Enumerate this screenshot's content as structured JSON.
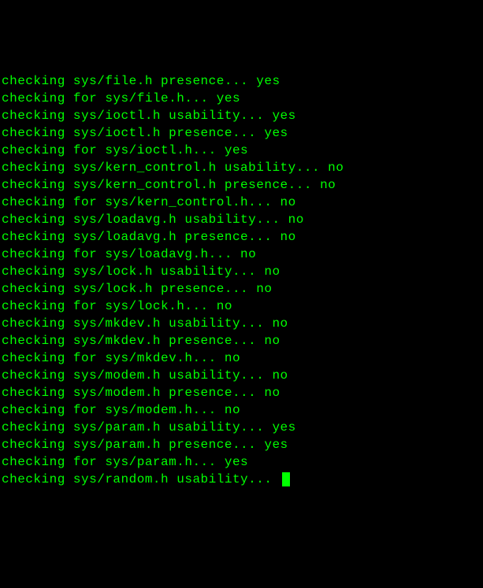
{
  "terminal": {
    "lines": [
      {
        "text": "checking sys/file.h presence... yes"
      },
      {
        "text": "checking for sys/file.h... yes"
      },
      {
        "text": "checking sys/ioctl.h usability... yes"
      },
      {
        "text": "checking sys/ioctl.h presence... yes"
      },
      {
        "text": "checking for sys/ioctl.h... yes"
      },
      {
        "text": "checking sys/kern_control.h usability... no"
      },
      {
        "text": "checking sys/kern_control.h presence... no"
      },
      {
        "text": "checking for sys/kern_control.h... no"
      },
      {
        "text": "checking sys/loadavg.h usability... no"
      },
      {
        "text": "checking sys/loadavg.h presence... no"
      },
      {
        "text": "checking for sys/loadavg.h... no"
      },
      {
        "text": "checking sys/lock.h usability... no"
      },
      {
        "text": "checking sys/lock.h presence... no"
      },
      {
        "text": "checking for sys/lock.h... no"
      },
      {
        "text": "checking sys/mkdev.h usability... no"
      },
      {
        "text": "checking sys/mkdev.h presence... no"
      },
      {
        "text": "checking for sys/mkdev.h... no"
      },
      {
        "text": "checking sys/modem.h usability... no"
      },
      {
        "text": "checking sys/modem.h presence... no"
      },
      {
        "text": "checking for sys/modem.h... no"
      },
      {
        "text": "checking sys/param.h usability... yes"
      },
      {
        "text": "checking sys/param.h presence... yes"
      },
      {
        "text": "checking for sys/param.h... yes"
      },
      {
        "text": "checking sys/random.h usability... ",
        "cursor": true
      }
    ]
  }
}
